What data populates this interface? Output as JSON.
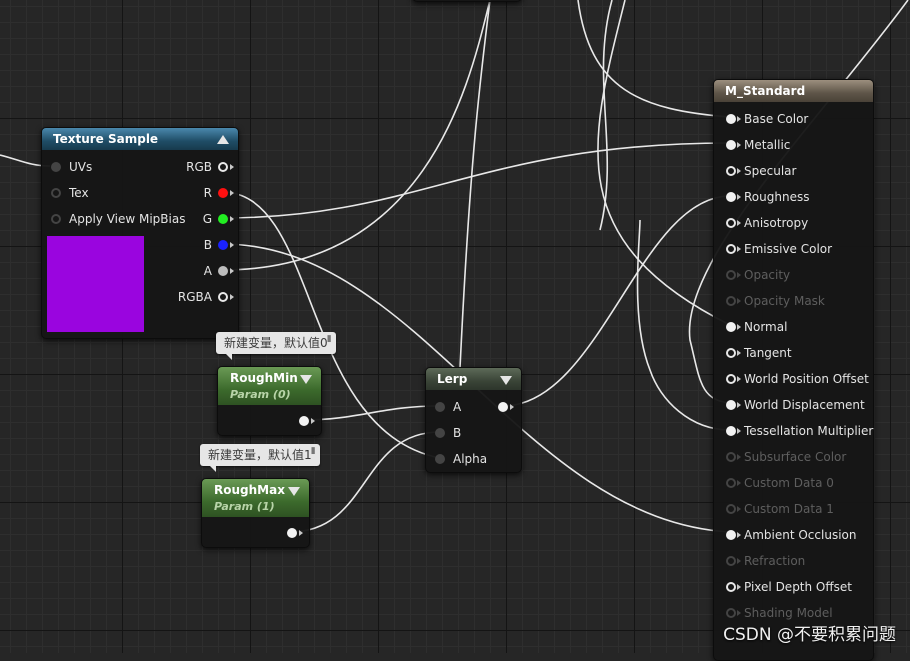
{
  "texture_sample": {
    "title": "Texture Sample",
    "inputs": [
      {
        "id": "uvs",
        "label": "UVs"
      },
      {
        "id": "tex",
        "label": "Tex"
      },
      {
        "id": "mipbias",
        "label": "Apply View MipBias"
      }
    ],
    "outputs": [
      {
        "id": "rgb",
        "label": "RGB"
      },
      {
        "id": "r",
        "label": "R"
      },
      {
        "id": "g",
        "label": "G"
      },
      {
        "id": "b",
        "label": "B"
      },
      {
        "id": "a",
        "label": "A"
      },
      {
        "id": "rgba",
        "label": "RGBA"
      }
    ],
    "preview_color": "#9a05df"
  },
  "rough_min": {
    "title": "RoughMin",
    "subtitle": "Param (0)",
    "comment": "新建变量，默认值0"
  },
  "rough_max": {
    "title": "RoughMax",
    "subtitle": "Param (1)",
    "comment": "新建变量，默认值1"
  },
  "lerp": {
    "title": "Lerp",
    "inputs": [
      {
        "id": "a",
        "label": "A"
      },
      {
        "id": "b",
        "label": "B"
      },
      {
        "id": "alpha",
        "label": "Alpha"
      }
    ]
  },
  "material": {
    "title": "M_Standard",
    "pins": [
      {
        "label": "Base Color",
        "state": "connected"
      },
      {
        "label": "Metallic",
        "state": "connected"
      },
      {
        "label": "Specular",
        "state": "open"
      },
      {
        "label": "Roughness",
        "state": "connected"
      },
      {
        "label": "Anisotropy",
        "state": "open"
      },
      {
        "label": "Emissive Color",
        "state": "open"
      },
      {
        "label": "Opacity",
        "state": "disabled"
      },
      {
        "label": "Opacity Mask",
        "state": "disabled"
      },
      {
        "label": "Normal",
        "state": "connected"
      },
      {
        "label": "Tangent",
        "state": "open"
      },
      {
        "label": "World Position Offset",
        "state": "open"
      },
      {
        "label": "World Displacement",
        "state": "connected"
      },
      {
        "label": "Tessellation Multiplier",
        "state": "connected"
      },
      {
        "label": "Subsurface Color",
        "state": "disabled"
      },
      {
        "label": "Custom Data 0",
        "state": "disabled"
      },
      {
        "label": "Custom Data 1",
        "state": "disabled"
      },
      {
        "label": "Ambient Occlusion",
        "state": "connected"
      },
      {
        "label": "Refraction",
        "state": "disabled"
      },
      {
        "label": "Pixel Depth Offset",
        "state": "open"
      },
      {
        "label": "Shading Model",
        "state": "disabled"
      }
    ]
  },
  "watermark": "CSDN @不要积累问题",
  "colors": {
    "wire": "#e8e8e8",
    "texture_header": "#1f4d66",
    "param_header": "#3c6a2c",
    "material_header": "#5e5548"
  }
}
